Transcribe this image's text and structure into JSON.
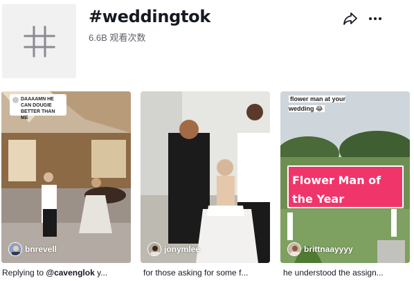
{
  "hashtag": {
    "title": "#weddingtok",
    "views": "6.6B 观看次数",
    "icon": "hashtag-icon"
  },
  "actions": {
    "share_icon": "share-arrow-icon",
    "more_icon": "more-horizontal-icon"
  },
  "videos": [
    {
      "bubble_text": "DAAAAMN HE CAN DOUGIE BETTER THAN ME",
      "username": "bnrevell",
      "desc_mention": "@cavenglok",
      "desc_prefix": "Replying to ",
      "desc_suffix": " y..."
    },
    {
      "username": "jonymlee",
      "desc": "for those asking for some f..."
    },
    {
      "overlay_caption": "flower man at your wedding 😂",
      "title_line1": "Flower Man of",
      "title_line2": "the Year",
      "username": "brittnaayyyy",
      "desc": "he understood the assign..."
    }
  ],
  "colors": {
    "accent": "#f0356b",
    "text": "#161823",
    "muted": "#5d5f66"
  }
}
